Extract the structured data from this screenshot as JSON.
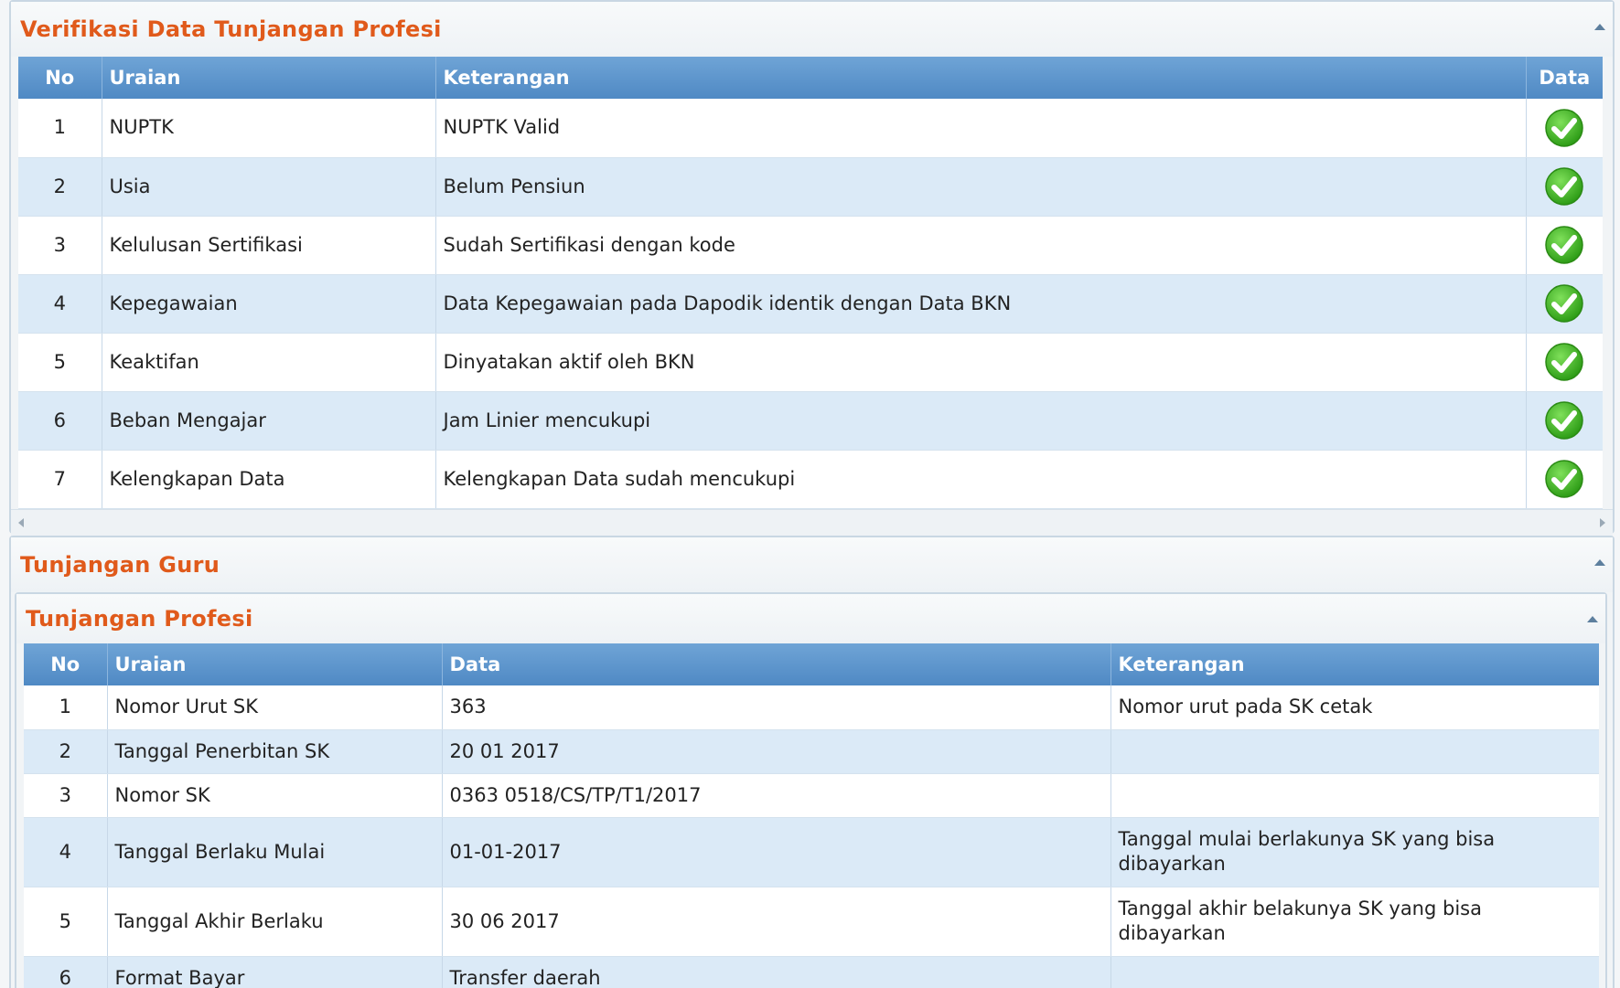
{
  "verifikasi": {
    "title": "Verifikasi Data Tunjangan Profesi",
    "columns": [
      "No",
      "Uraian",
      "Keterangan",
      "Data"
    ],
    "rows": [
      {
        "no": "1",
        "uraian": "NUPTK",
        "keterangan": "NUPTK Valid",
        "status_icon": "check-icon"
      },
      {
        "no": "2",
        "uraian": "Usia",
        "keterangan": "Belum Pensiun",
        "status_icon": "check-icon"
      },
      {
        "no": "3",
        "uraian": "Kelulusan Sertifikasi",
        "keterangan": "Sudah Sertifikasi dengan kode",
        "status_icon": "check-icon"
      },
      {
        "no": "4",
        "uraian": "Kepegawaian",
        "keterangan": "Data Kepegawaian pada Dapodik identik dengan Data BKN",
        "status_icon": "check-icon"
      },
      {
        "no": "5",
        "uraian": "Keaktifan",
        "keterangan": "Dinyatakan aktif oleh BKN",
        "status_icon": "check-icon"
      },
      {
        "no": "6",
        "uraian": "Beban Mengajar",
        "keterangan": "Jam Linier mencukupi",
        "status_icon": "check-icon"
      },
      {
        "no": "7",
        "uraian": "Kelengkapan Data",
        "keterangan": "Kelengkapan Data sudah mencukupi",
        "status_icon": "check-icon"
      }
    ]
  },
  "tunjangan_guru": {
    "title": "Tunjangan Guru"
  },
  "tunjangan_profesi": {
    "title": "Tunjangan Profesi",
    "columns": [
      "No",
      "Uraian",
      "Data",
      "Keterangan"
    ],
    "rows": [
      {
        "no": "1",
        "uraian": "Nomor Urut SK",
        "data": "363",
        "keterangan": "Nomor urut pada SK cetak"
      },
      {
        "no": "2",
        "uraian": "Tanggal Penerbitan SK",
        "data": "20 01 2017",
        "keterangan": ""
      },
      {
        "no": "3",
        "uraian": "Nomor SK",
        "data": "0363 0518/CS/TP/T1/2017",
        "keterangan": ""
      },
      {
        "no": "4",
        "uraian": "Tanggal Berlaku Mulai",
        "data": "01-01-2017",
        "keterangan": "Tanggal mulai berlakunya SK yang bisa dibayarkan"
      },
      {
        "no": "5",
        "uraian": "Tanggal Akhir Berlaku",
        "data": "30 06 2017",
        "keterangan": "Tanggal akhir belakunya SK yang bisa dibayarkan"
      },
      {
        "no": "6",
        "uraian": "Format Bayar",
        "data": "Transfer daerah",
        "keterangan": ""
      }
    ]
  },
  "colors": {
    "title_orange": "#e05a1b",
    "header_blue": "#4f89c4",
    "row_alt": "#dbeaf7",
    "check_green": "#3cb521"
  }
}
